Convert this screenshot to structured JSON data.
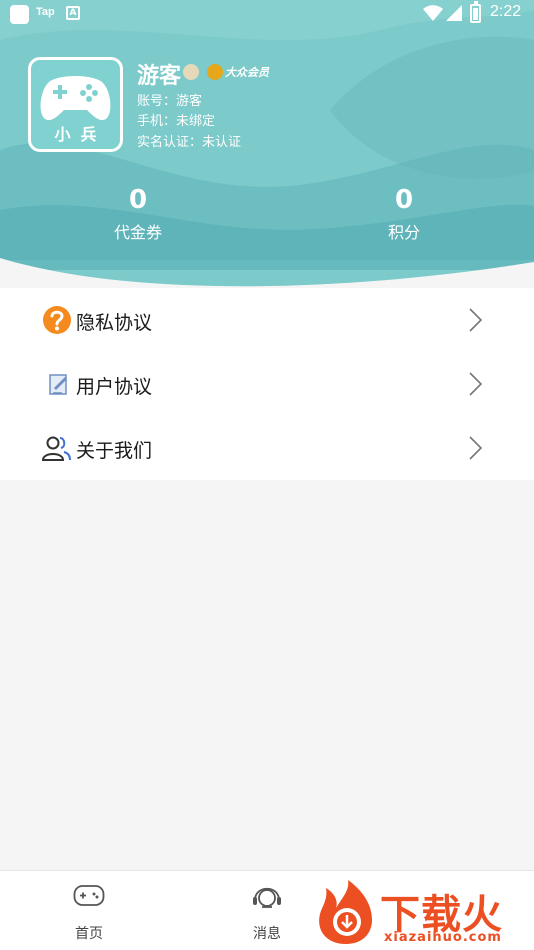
{
  "status_bar": {
    "app_label": "Tap",
    "app_letter": "A",
    "time": "2:22"
  },
  "profile": {
    "avatar_text": "小兵",
    "name": "游客",
    "vip_label": "大众会员",
    "account": "账号：游客",
    "phone": "手机：未绑定",
    "real_name": "实名认证：未认证"
  },
  "stats": [
    {
      "value": "0",
      "label": "代金券"
    },
    {
      "value": "0",
      "label": "积分"
    }
  ],
  "menu": [
    {
      "label": "隐私协议",
      "icon": "question-icon"
    },
    {
      "label": "用户协议",
      "icon": "edit-document-icon"
    },
    {
      "label": "关于我们",
      "icon": "users-icon"
    }
  ],
  "bottom_nav": [
    {
      "label": "首页",
      "icon": "gamepad-icon"
    },
    {
      "label": "消息",
      "icon": "headset-icon"
    }
  ],
  "watermark": {
    "title": "下载火",
    "subtitle": "xiazaihuo.com"
  },
  "colors": {
    "header_teal": "#79c7c7",
    "accent_orange": "#f58a1f",
    "watermark_red": "#ec4f22"
  }
}
